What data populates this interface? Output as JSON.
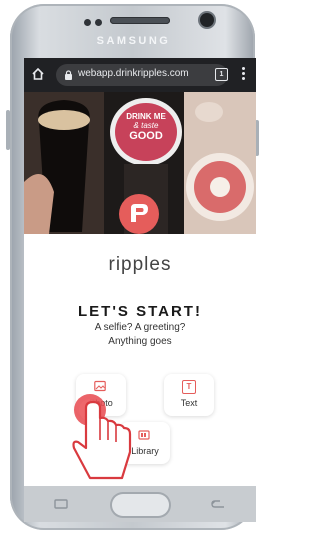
{
  "device": {
    "brand": "SAMSUNG"
  },
  "browser": {
    "url": "webapp.drinkripples.com",
    "tabs_count": "1"
  },
  "hero": {
    "coaster_text_line1": "DRINK ME",
    "coaster_text_line2": "& taste",
    "coaster_text_line3": "GOOD"
  },
  "app": {
    "logo_text": "ripples"
  },
  "main": {
    "title": "LET'S START!",
    "subtitle_line1": "A selfie? A greeting?",
    "subtitle_line2": "Anything goes",
    "options": [
      {
        "label": "Photo",
        "icon": "image-icon"
      },
      {
        "label": "Text",
        "icon": "text-icon"
      },
      {
        "label": "Library",
        "icon": "library-icon"
      }
    ]
  },
  "colors": {
    "accent": "#e55d5b",
    "urlbar": "#202124"
  }
}
